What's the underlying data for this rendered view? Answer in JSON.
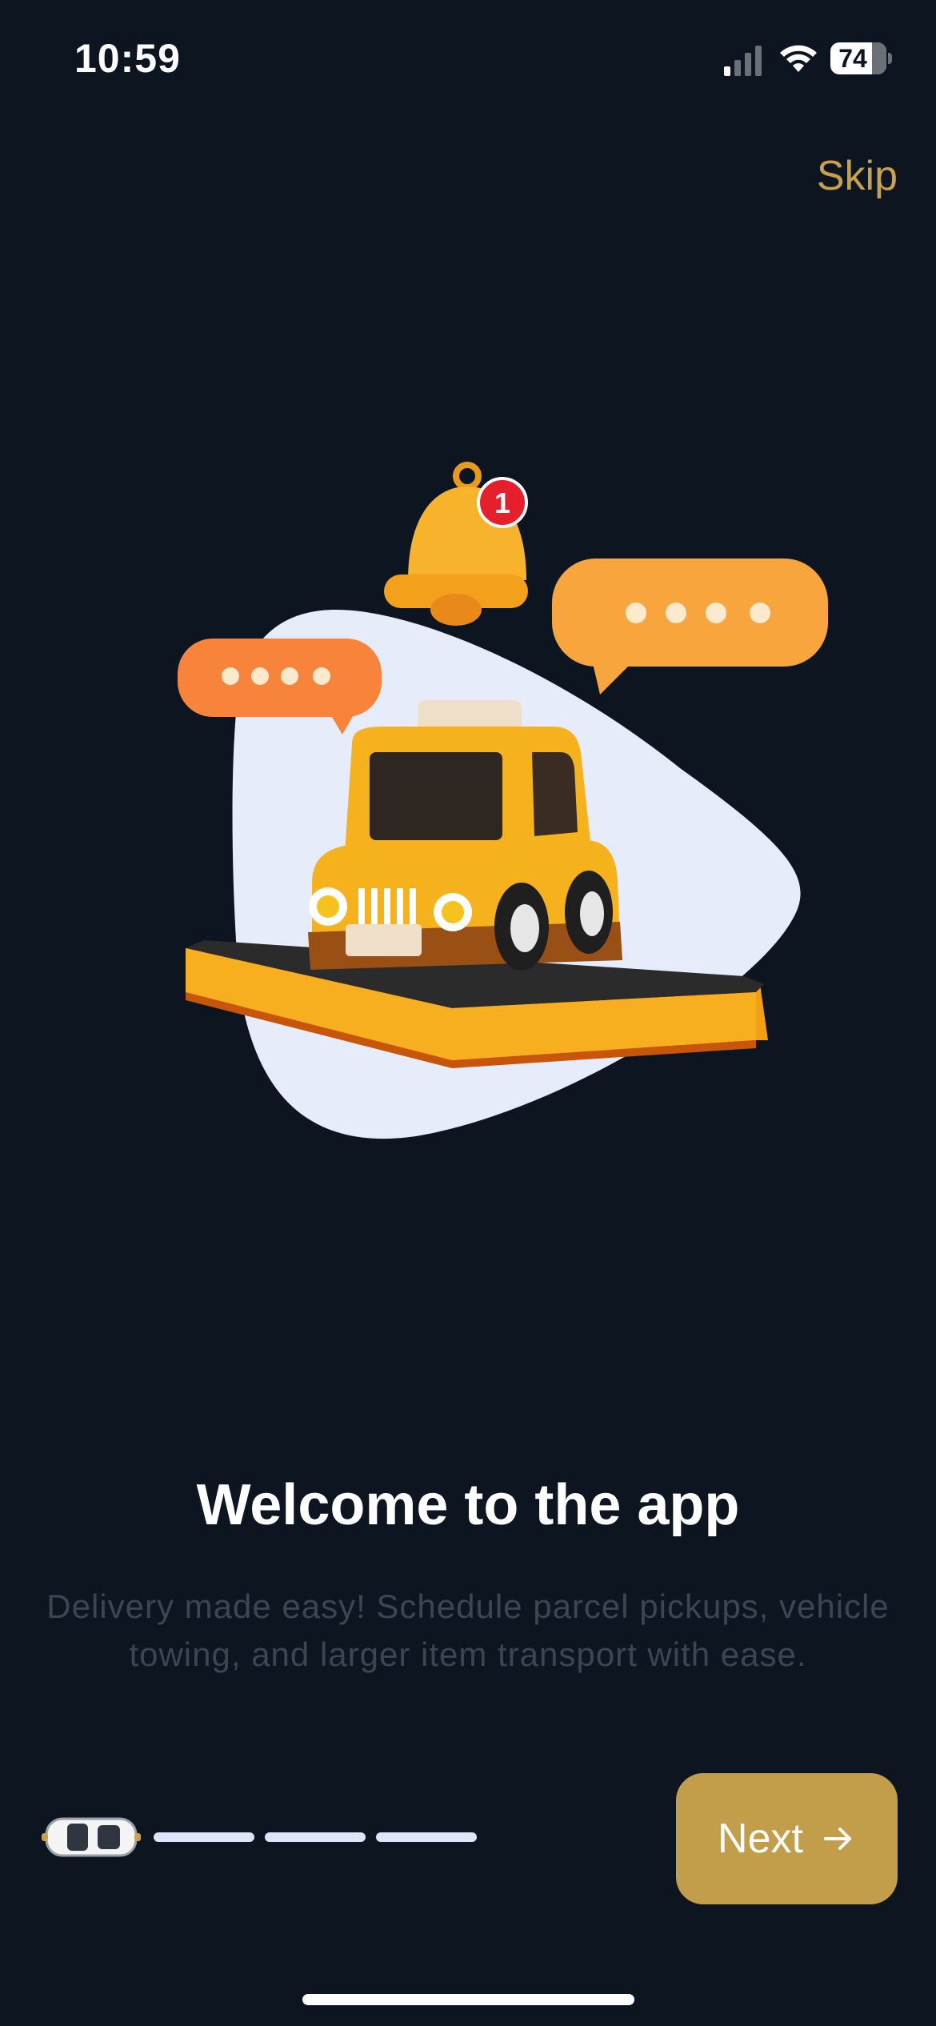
{
  "status_bar": {
    "time": "10:59",
    "battery_level": "74",
    "battery_fraction": 0.74,
    "icons": [
      "signal-icon",
      "wifi-icon",
      "battery-icon"
    ]
  },
  "header": {
    "skip_label": "Skip"
  },
  "illustration": {
    "notification_badge": "1",
    "icons": [
      "bell-icon",
      "chat-bubble-icon",
      "taxi-car-icon"
    ]
  },
  "content": {
    "title": "Welcome to the app",
    "description": "Delivery made easy! Schedule parcel pickups, vehicle towing, and larger item transport with ease."
  },
  "pager": {
    "current_page": 1,
    "total_pages": 4,
    "indicator_icon": "car-icon"
  },
  "footer": {
    "next_label": "Next",
    "next_icon": "arrow-right-icon"
  },
  "colors": {
    "background": "#0d1521",
    "accent": "#c29e4b",
    "skip_text": "#c9a14d",
    "subtitle_text": "#3c4552",
    "blob": "#e7ecfb",
    "progress_dash": "#dbe6fb"
  }
}
